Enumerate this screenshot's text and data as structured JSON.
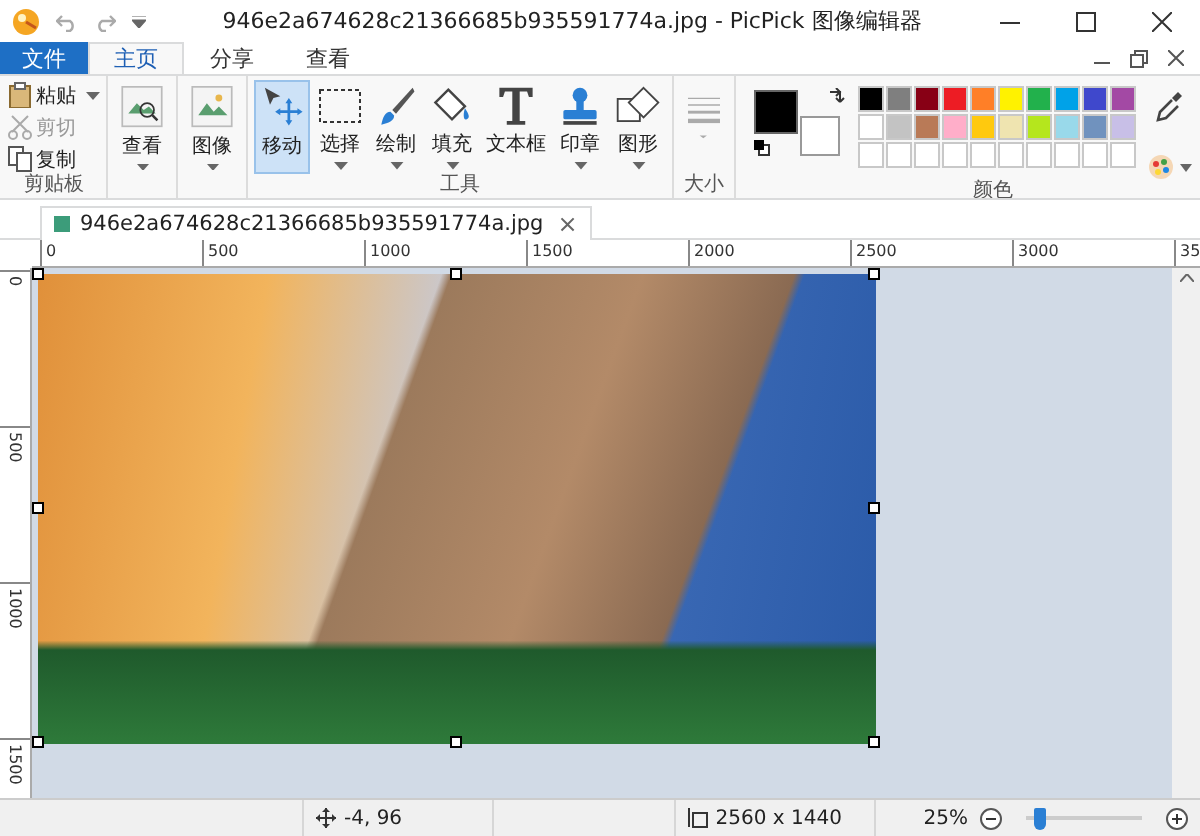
{
  "window": {
    "title": "946e2a674628c21366685b935591774a.jpg - PicPick 图像编辑器"
  },
  "ribbon_tabs": [
    {
      "label": "文件",
      "kind": "file",
      "selected": false
    },
    {
      "label": "主页",
      "kind": "tab",
      "selected": true
    },
    {
      "label": "分享",
      "kind": "tab",
      "selected": false
    },
    {
      "label": "查看",
      "kind": "tab",
      "selected": false
    }
  ],
  "clipboard": {
    "label": "剪贴板",
    "items": [
      {
        "label": "粘贴",
        "kind": "paste",
        "disabled": false,
        "has_menu": true
      },
      {
        "label": "剪切",
        "kind": "cut",
        "disabled": true,
        "has_menu": false
      },
      {
        "label": "复制",
        "kind": "copy",
        "disabled": false,
        "has_menu": false
      }
    ]
  },
  "view_buttons": [
    {
      "label": "查看",
      "kind": "view",
      "has_menu": true
    },
    {
      "label": "图像",
      "kind": "image",
      "has_menu": true
    }
  ],
  "tools": {
    "label": "工具",
    "items": [
      {
        "label": "移动",
        "kind": "move",
        "selected": true,
        "has_menu": false
      },
      {
        "label": "选择",
        "kind": "select",
        "selected": false,
        "has_menu": true
      },
      {
        "label": "绘制",
        "kind": "draw",
        "selected": false,
        "has_menu": true
      },
      {
        "label": "填充",
        "kind": "fill",
        "selected": false,
        "has_menu": true
      },
      {
        "label": "文本框",
        "kind": "text",
        "selected": false,
        "has_menu": false
      },
      {
        "label": "印章",
        "kind": "stamp",
        "selected": false,
        "has_menu": true
      },
      {
        "label": "图形",
        "kind": "shape",
        "selected": false,
        "has_menu": true
      }
    ]
  },
  "size": {
    "label": "大小"
  },
  "colors": {
    "label": "颜色",
    "current": [
      {
        "kind": "primary",
        "color": "#000000"
      },
      {
        "kind": "secondary",
        "color": "#ffffff"
      }
    ],
    "palette": [
      {
        "color": "#000000"
      },
      {
        "color": "#7f7f7f"
      },
      {
        "color": "#880015"
      },
      {
        "color": "#ed1c24"
      },
      {
        "color": "#ff7f27"
      },
      {
        "color": "#fff200"
      },
      {
        "color": "#22b14c"
      },
      {
        "color": "#00a2e8"
      },
      {
        "color": "#3f48cc"
      },
      {
        "color": "#a349a4"
      },
      {
        "color": "#ffffff"
      },
      {
        "color": "#c3c3c3"
      },
      {
        "color": "#b97a57"
      },
      {
        "color": "#ffaec9"
      },
      {
        "color": "#ffc90e"
      },
      {
        "color": "#efe4b0"
      },
      {
        "color": "#b5e61d"
      },
      {
        "color": "#99d9ea"
      },
      {
        "color": "#7092be"
      },
      {
        "color": "#c8bfe7"
      },
      {
        "color": "#ffffff"
      },
      {
        "color": "#ffffff"
      },
      {
        "color": "#ffffff"
      },
      {
        "color": "#ffffff"
      },
      {
        "color": "#ffffff"
      },
      {
        "color": "#ffffff"
      },
      {
        "color": "#ffffff"
      },
      {
        "color": "#ffffff"
      },
      {
        "color": "#ffffff"
      },
      {
        "color": "#ffffff"
      }
    ]
  },
  "document_tab": {
    "label": "946e2a674628c21366685b935591774a.jpg",
    "close": "×"
  },
  "ruler": {
    "horizontal": [
      "0",
      "500",
      "1000",
      "1500",
      "2000",
      "2500",
      "3000",
      "35"
    ],
    "vertical": [
      "0",
      "500",
      "1000",
      "1500"
    ]
  },
  "status_bar": {
    "cursor": "-4, 96",
    "image_size": "2560 x 1440",
    "zoom": "25%",
    "zoom_slider": {
      "level": 0.08
    }
  }
}
